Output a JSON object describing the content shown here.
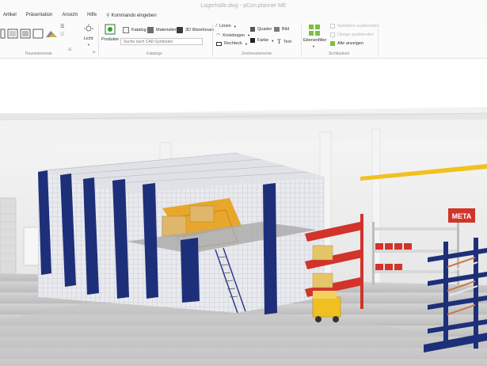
{
  "window": {
    "title": "Lagerhalle.dwg - pCon.planner ME"
  },
  "menu": [
    "Artikel",
    "Präsentation",
    "Ansicht",
    "Hilfe"
  ],
  "command_entry": "Kommando eingeben",
  "ribbon": {
    "groups": {
      "raumelemente": "Raumelemente",
      "kataloge": "Kataloge",
      "zeichenelemente": "Zeichenelemente",
      "sichtbarkeit": "Sichtbarkeit"
    },
    "licht": "Licht",
    "produkte": "Produkte",
    "katalog": "Katalog",
    "materialien": "Materialien",
    "warehouse": "3D Warehouse",
    "search_placeholder": "Suche nach CAD-Symbolen",
    "linien": "Linien",
    "kreisbogen": "Kreisbogen",
    "rechteck": "Rechteck",
    "quader": "Quader",
    "farbe": "Farbe",
    "bild": "Bild",
    "text": "Text",
    "ebenenfilter": "Ebenenfilter",
    "selektion_ausblenden": "Selektion ausblenden",
    "uebrige_ausblenden": "Übrige ausblenden",
    "alle_anzeigen": "Alle anzeigen"
  },
  "scene": {
    "sign_text": "META"
  },
  "colors": {
    "rack_blue": "#1e2f7a",
    "mezzanine_orange": "#e6a72c",
    "beam_red": "#d2332a",
    "crane_yellow": "#f1c11f",
    "floor": "#c9c9c9"
  }
}
